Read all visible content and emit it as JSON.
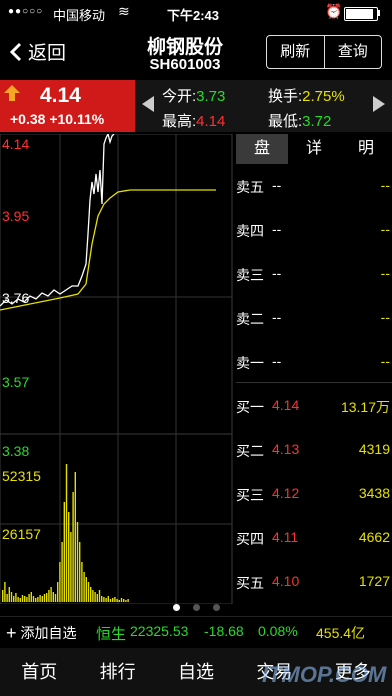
{
  "status": {
    "signal": "●●○○○",
    "carrier": "中国移动",
    "time": "下午2:43"
  },
  "nav": {
    "back": "返回",
    "title": "柳钢股份",
    "code": "SH601003",
    "refresh": "刷新",
    "query": "查询"
  },
  "quote": {
    "price": "4.14",
    "change": "+0.38 +10.11%",
    "open_label": "今开:",
    "open": "3.73",
    "turnover_label": "换手:",
    "turnover": "2.75%",
    "high_label": "最高:",
    "high": "4.14",
    "low_label": "最低:",
    "low": "3.72"
  },
  "chart": {
    "y_labels": [
      "4.14",
      "3.95",
      "3.76",
      "3.57",
      "3.38"
    ],
    "vol_labels": [
      "52315",
      "26157"
    ]
  },
  "book": {
    "tabs": [
      "盘",
      "详",
      "明"
    ],
    "sell": [
      {
        "label": "卖五",
        "price": "--",
        "vol": "--"
      },
      {
        "label": "卖四",
        "price": "--",
        "vol": "--"
      },
      {
        "label": "卖三",
        "price": "--",
        "vol": "--"
      },
      {
        "label": "卖二",
        "price": "--",
        "vol": "--"
      },
      {
        "label": "卖一",
        "price": "--",
        "vol": "--"
      }
    ],
    "buy": [
      {
        "label": "买一",
        "price": "4.14",
        "vol": "13.17万"
      },
      {
        "label": "买二",
        "price": "4.13",
        "vol": "4319"
      },
      {
        "label": "买三",
        "price": "4.12",
        "vol": "3438"
      },
      {
        "label": "买四",
        "price": "4.11",
        "vol": "4662"
      },
      {
        "label": "买五",
        "price": "4.10",
        "vol": "1727"
      }
    ]
  },
  "index": {
    "add": "添加自选",
    "name": "恒生",
    "value": "22325.53",
    "change": "-18.68",
    "pct": "0.08%",
    "amount": "455.4亿"
  },
  "tabbar": [
    "首页",
    "排行",
    "自选",
    "交易",
    "更多"
  ],
  "watermark": "ITMOP.COM"
}
